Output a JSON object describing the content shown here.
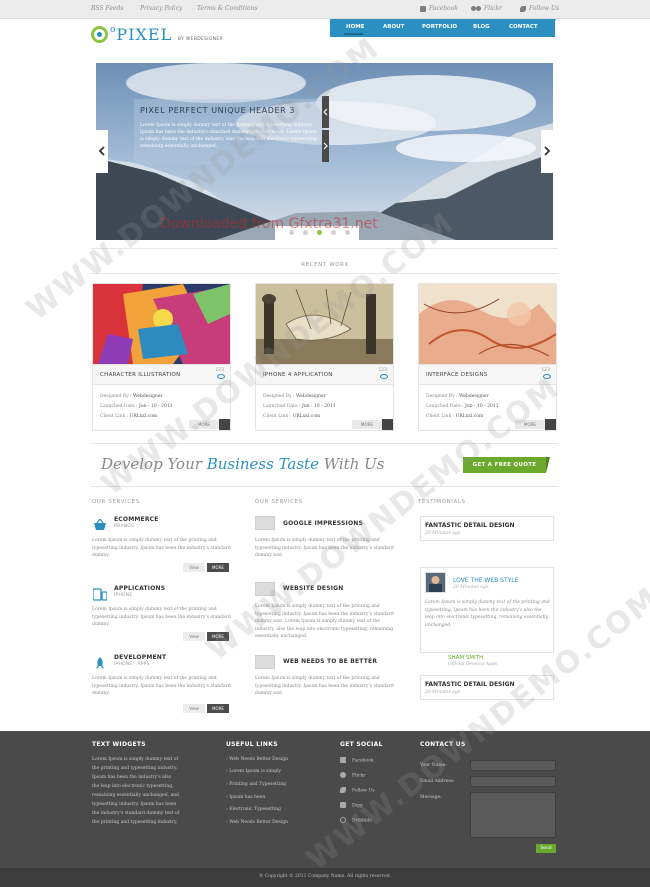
{
  "topbar": {
    "links": [
      "RSS Feeds",
      "Privacy Policy",
      "Terms & Conditions"
    ],
    "social": [
      "Facebook",
      "Flickr",
      "Follow Us"
    ]
  },
  "logo": {
    "brand": "PIXEL",
    "prefix": "o",
    "tagline": "BY WEBDESIGNER"
  },
  "nav": {
    "items": [
      "HOME",
      "ABOUT",
      "PORTFOLIO",
      "BLOG",
      "CONTACT"
    ]
  },
  "slider": {
    "title": "PIXEL PERFECT UNIQUE HEADER 3",
    "text": "Lorem Ipsum is simply dummy text of the printing and typesetting industry. Ipsum has been the industry's standard dummy text ever since. Lorem Ipsum is simply dummy text of the industry, also the leap into electronic typesetting, remaining essentially unchanged.",
    "overlay_watermark": "Downloaded from Gfxtra31.net",
    "pager": {
      "count": 5,
      "active": 3
    }
  },
  "recent_work": {
    "heading": "RECENT WORK",
    "items": [
      {
        "title": "CHARACTER ILLUSTRATION",
        "count": "123",
        "designed_by_label": "Designed By :",
        "designed_by": "Webdesigner",
        "launched_label": "Launched Date :",
        "launched": "Jun - 10 - 2011",
        "client_label": "Client Link :",
        "client": "URLxxl.com",
        "more": "MORE"
      },
      {
        "title": "IPHONE 4 APPLICATION",
        "count": "123",
        "designed_by_label": "Designed By :",
        "designed_by": "Webdesigner",
        "launched_label": "Launched Date :",
        "launched": "Jun - 10 - 2011",
        "client_label": "Client Link :",
        "client": "URLxxl.com",
        "more": "MORE"
      },
      {
        "title": "INTERFACE DESIGNS",
        "count": "123",
        "designed_by_label": "Designed By :",
        "designed_by": "Webdesigner",
        "launched_label": "Launched Date :",
        "launched": "Jun - 10 - 2011",
        "client_label": "Client Link :",
        "client": "URLxxl.com",
        "more": "MORE"
      }
    ]
  },
  "cta": {
    "prefix": "Develop Your ",
    "emphasis": "Business Taste",
    "suffix": " With Us",
    "button": "GET A FREE QUOTE"
  },
  "services_left": {
    "heading": "OUR SERVICES",
    "items": [
      {
        "title": "ECOMMERCE",
        "sub": "BRANDS",
        "body": "Lorem Ipsum is simply dummy text of the printing and typesetting industry. Ipsum has been the industry's standard dummy.",
        "view": "View",
        "more": "MORE",
        "icon": "basket-icon"
      },
      {
        "title": "APPLICATIONS",
        "sub": "IPHONE",
        "body": "Lorem Ipsum is simply dummy text of the printing and typesetting industry. Ipsum has been the industry's standard dummy.",
        "view": "View",
        "more": "MORE",
        "icon": "devices-icon"
      },
      {
        "title": "DEVELOPMENT",
        "sub": "IPHONE - APPS",
        "body": "Lorem Ipsum is simply dummy text of the printing and typesetting industry. Ipsum has been the industry's standard dummy.",
        "view": "View",
        "more": "MORE",
        "icon": "rocket-icon"
      }
    ]
  },
  "services_right": {
    "heading": "OUR SERVICES",
    "items": [
      {
        "title": "GOOGLE IMPRESSIONS",
        "body": "Lorem Ipsum is simply dummy text of the printing and typesetting industry. Ipsum has been the industry's standard dummy text."
      },
      {
        "title": "WEBSITE DESIGN",
        "body": "Lorem Ipsum is simply dummy text of the printing and typesetting industry. Ipsum has been the industry's standard dummy text. Lorem Ipsum is simply dummy text of the industry, also the leap into electronic typesetting, remaining essentially unchanged."
      },
      {
        "title": "WEB NEEDS TO BE BETTER",
        "body": "Lorem Ipsum is simply dummy text of the printing and typesetting industry. Ipsum has been the industry's standard dummy text."
      }
    ]
  },
  "testimonials": {
    "heading": "TESTIMONIALS",
    "items": [
      {
        "title": "FANTASTIC DETAIL DESIGN",
        "time": "20 Minutes ago"
      },
      {
        "title": "LOVE THE WEB STYLE",
        "time": "20 Minutes ago",
        "quote": "Lorem Ipsum is simply dummy text of the printing and typesetting. Ipsum has been the industry's also the leap into electronic typesetting, remaining essentially unchanged.",
        "author": "SHAM SMITH",
        "author_role": "Official Develop Apps"
      },
      {
        "title": "FANTASTIC DETAIL DESIGN",
        "time": "20 Minutes ago"
      }
    ]
  },
  "footer": {
    "text_widgets": {
      "heading": "TEXT WIDGETS",
      "body": "Lorem Ipsum is simply dummy text of the printing and typesetting industry. Ipsum has been the industry's also the leap into electronic typesetting, remaining essentially unchanged, and typesetting industry. Ipsum has been the industry's standard dummy text of the printing and typesetting industry."
    },
    "useful_links": {
      "heading": "USEFUL LINKS",
      "items": [
        "Web Needs Better Design",
        "Lorem Ipsum is simply",
        "Printing and Typesetting",
        "Ipsum has been",
        "Electronic Typesetting",
        "Web Needs Better Design"
      ]
    },
    "social": {
      "heading": "GET SOCIAL",
      "items": [
        "Facebook",
        "Flickr",
        "Follow Us",
        "Digg",
        "Dribbble"
      ]
    },
    "contact": {
      "heading": "CONTACT US",
      "name_label": "Your Name:",
      "email_label": "Email Address:",
      "message_label": "Message:",
      "send": "Send"
    },
    "copyright": "© Copyright © 2011 Company Name. All rights reserved."
  },
  "watermark_text": "WWW.DOWNDEMO.COM",
  "colors": {
    "accent_blue": "#2b8fc1",
    "accent_green": "#6aa92e",
    "footer_bg": "#4a4a4a"
  }
}
